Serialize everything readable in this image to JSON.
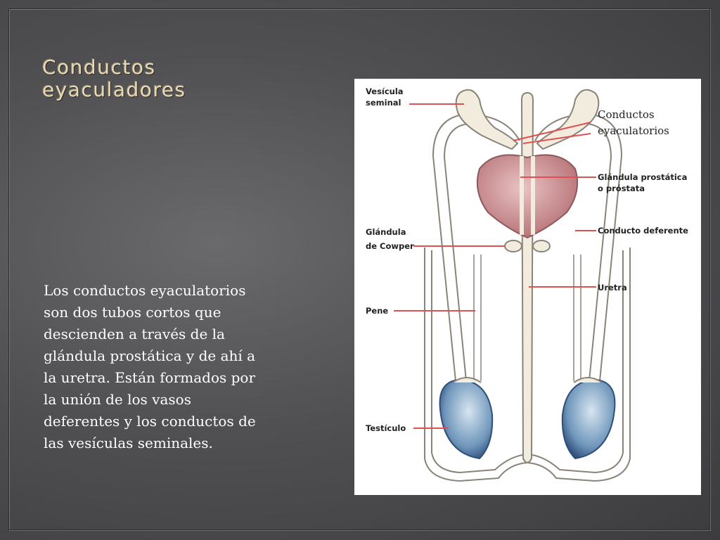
{
  "slide": {
    "title_line1": "Conductos",
    "title_line2": "eyaculadores",
    "body": "Los conductos eyaculatorios son dos tubos cortos que descienden a través de la glándula prostática y de ahí a la uretra. Están formados por la unión de los vasos deferentes y los conductos de las vesículas seminales."
  },
  "diagram": {
    "labels": {
      "vesicula_line1": "Vesícula",
      "vesicula_line2": "seminal",
      "conductos_line1": "Conductos",
      "conductos_line2": "eyaculatorios",
      "prostata_line1": "Glándula prostática",
      "prostata_line2": "o próstata",
      "deferente": "Conducto deferente",
      "cowper_line1": "Glándula",
      "cowper_line2": "de Cowper",
      "uretra": "Uretra",
      "pene": "Pene",
      "testiculo": "Testículo"
    },
    "colors": {
      "leader_line": "#e05050",
      "tissue": "#f2ecdf",
      "tissue_outline": "#8a8478",
      "prostate": "#c98a8d",
      "testis": "#7ea3c4"
    }
  }
}
